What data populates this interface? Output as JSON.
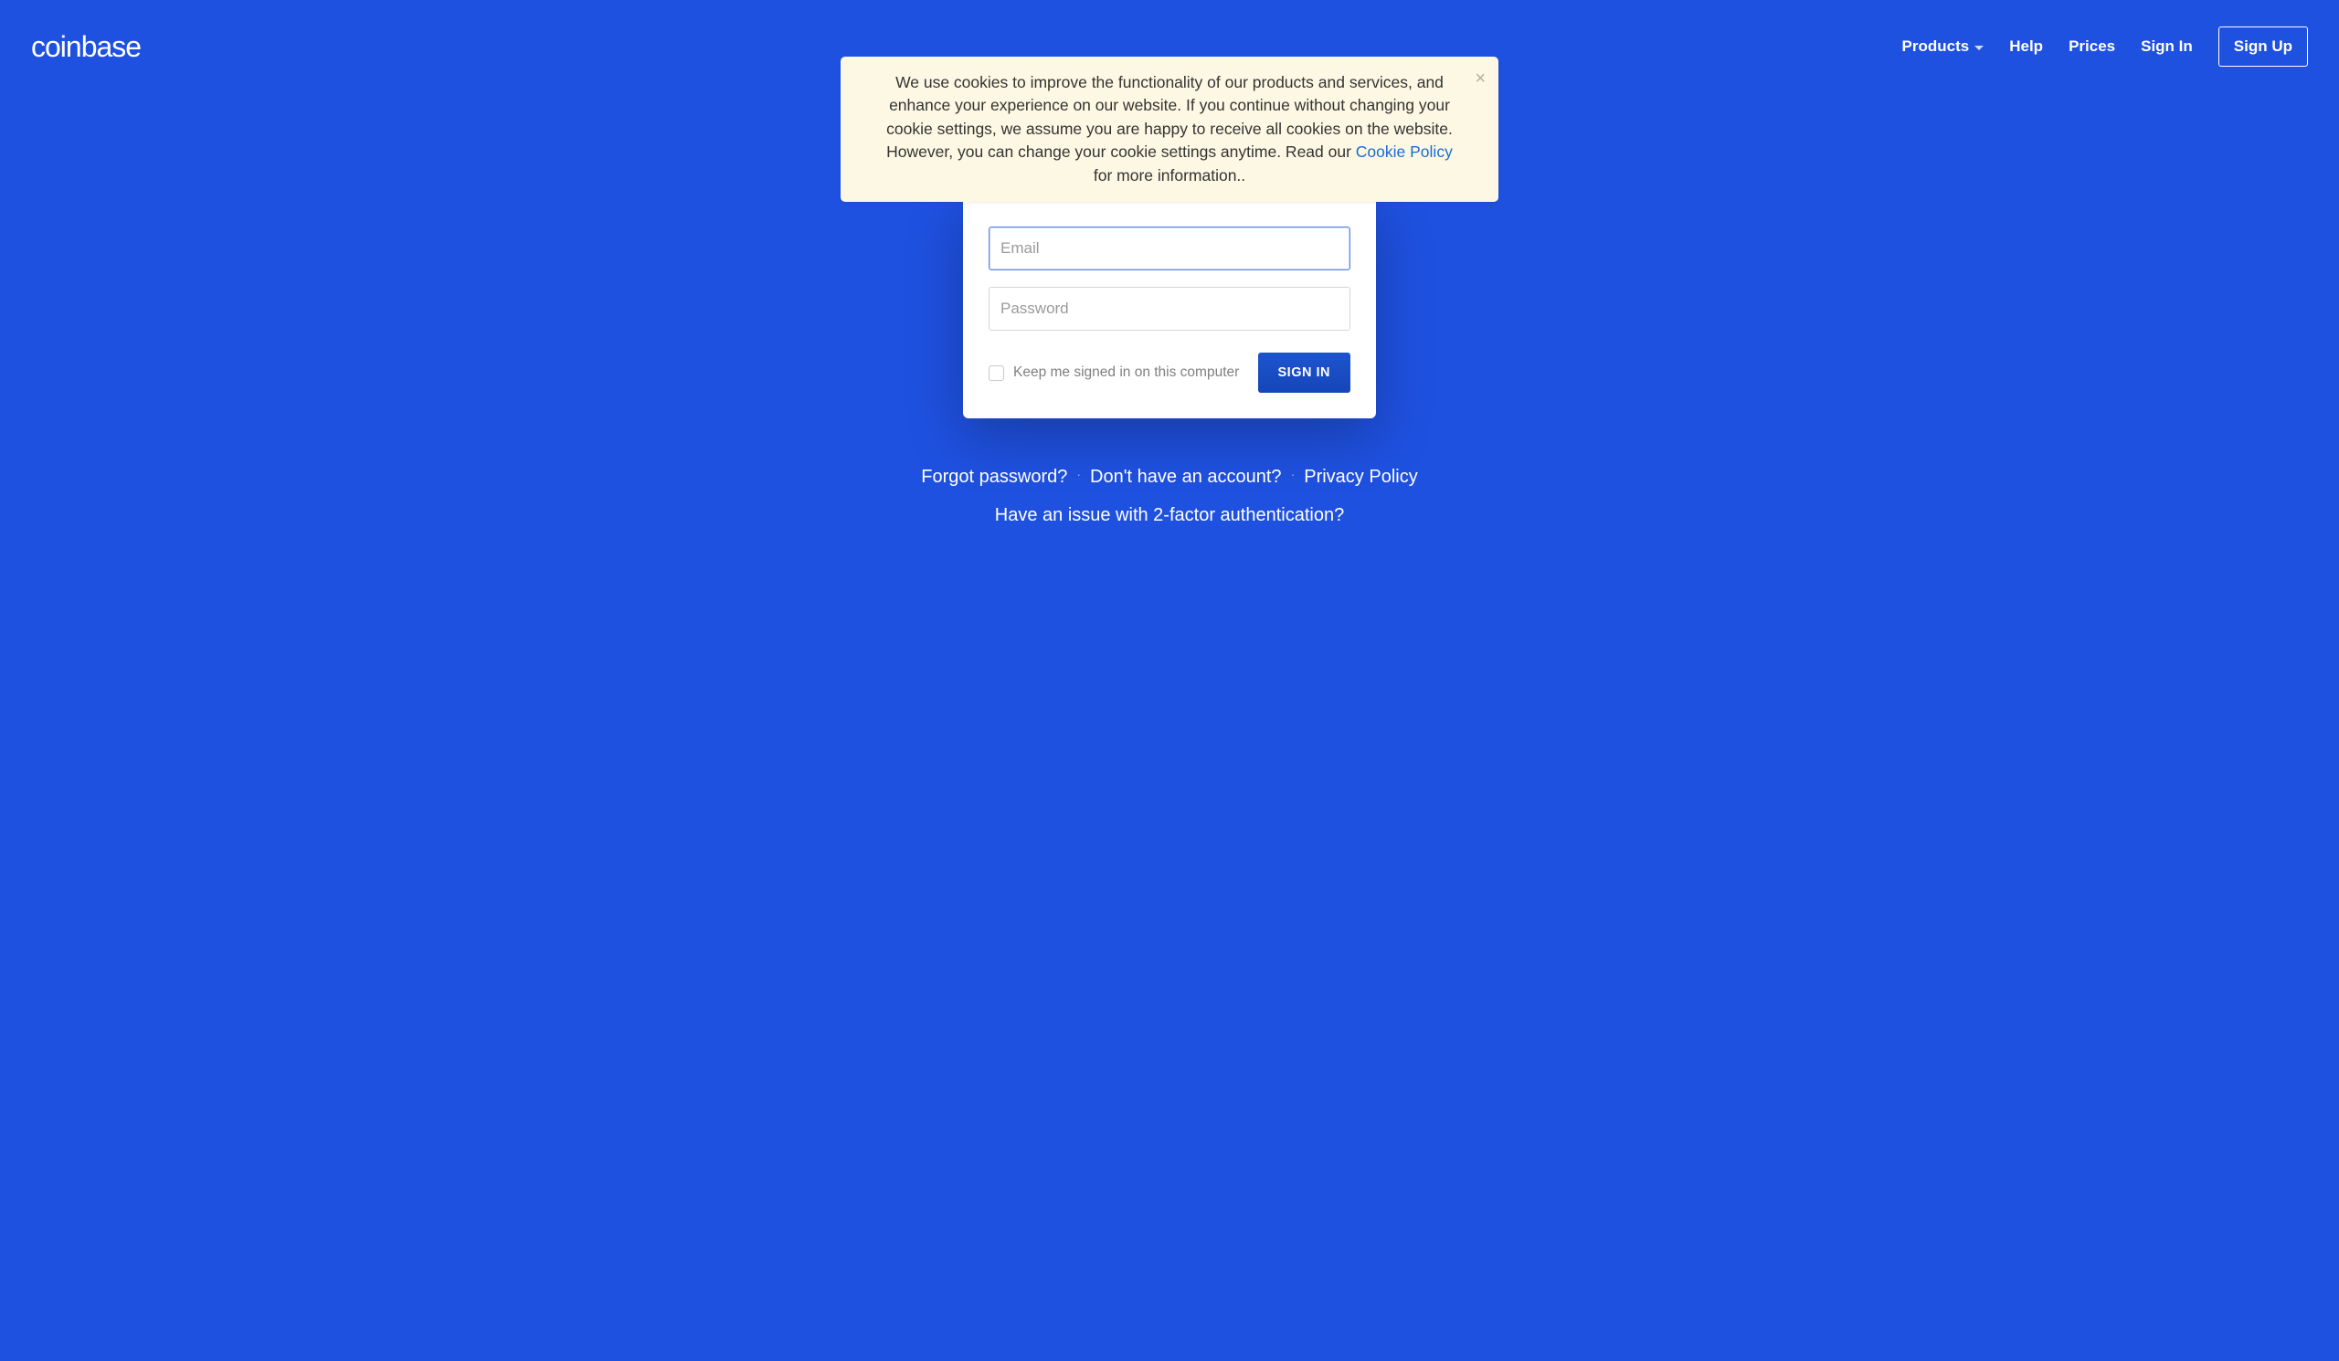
{
  "brand": "coinbase",
  "nav": {
    "products": "Products",
    "help": "Help",
    "prices": "Prices",
    "signin": "Sign In",
    "signup": "Sign Up"
  },
  "cookie": {
    "text_before": "We use cookies to improve the functionality of our products and services, and enhance your experience on our website. If you continue without changing your cookie settings, we assume you are happy to receive all cookies on the website. However, you can change your cookie settings anytime. Read our ",
    "policy_link": "Cookie Policy",
    "text_after": " for more information..",
    "close_symbol": "×"
  },
  "form": {
    "email_placeholder": "Email",
    "password_placeholder": "Password",
    "keep_signed_in": "Keep me signed in on this computer",
    "signin_button": "SIGN IN"
  },
  "links": {
    "forgot": "Forgot password?",
    "no_account": "Don't have an account?",
    "privacy": "Privacy Policy",
    "twofa": "Have an issue with 2-factor authentication?",
    "sep": "·"
  }
}
